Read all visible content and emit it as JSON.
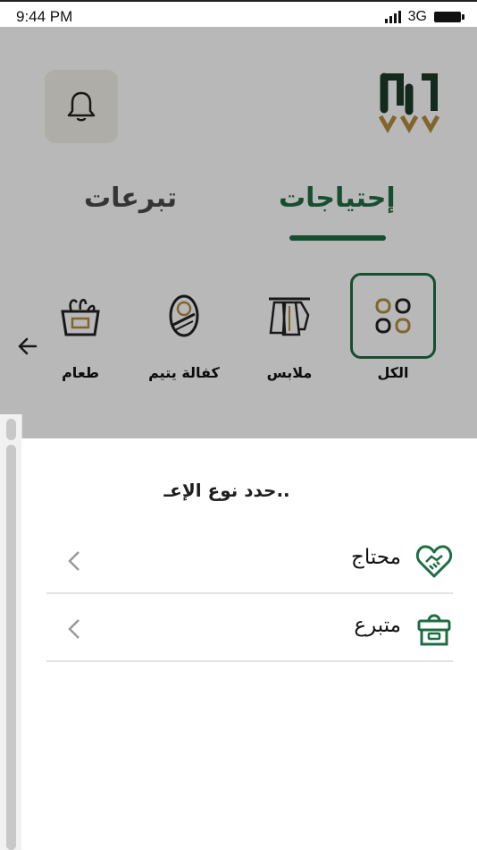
{
  "status_bar": {
    "time": "9:44 PM",
    "network": "3G"
  },
  "header": {
    "notifications_icon": "bell-icon",
    "logo_icon": "jood-logo-icon"
  },
  "tabs": [
    {
      "label": "إحتياجات",
      "active": true
    },
    {
      "label": "تبرعات",
      "active": false
    }
  ],
  "categories": [
    {
      "label": "الكل",
      "icon": "grid-icon",
      "active": true
    },
    {
      "label": "ملابس",
      "icon": "clothes-rack-icon",
      "active": false
    },
    {
      "label": "كفالة يتيم",
      "icon": "baby-icon",
      "active": false
    },
    {
      "label": "طعام",
      "icon": "grocery-basket-icon",
      "active": false
    }
  ],
  "categories_more_icon": "arrow-left-icon",
  "sheet": {
    "title": "حدد نوع الإعـ..",
    "options": [
      {
        "label": "محتاج",
        "icon": "heart-handshake-icon"
      },
      {
        "label": "متبرع",
        "icon": "donation-box-icon"
      }
    ]
  },
  "colors": {
    "primary": "#1f6d43",
    "accent": "#b58c3e",
    "overlay": "rgba(0,0,0,0.28)"
  }
}
